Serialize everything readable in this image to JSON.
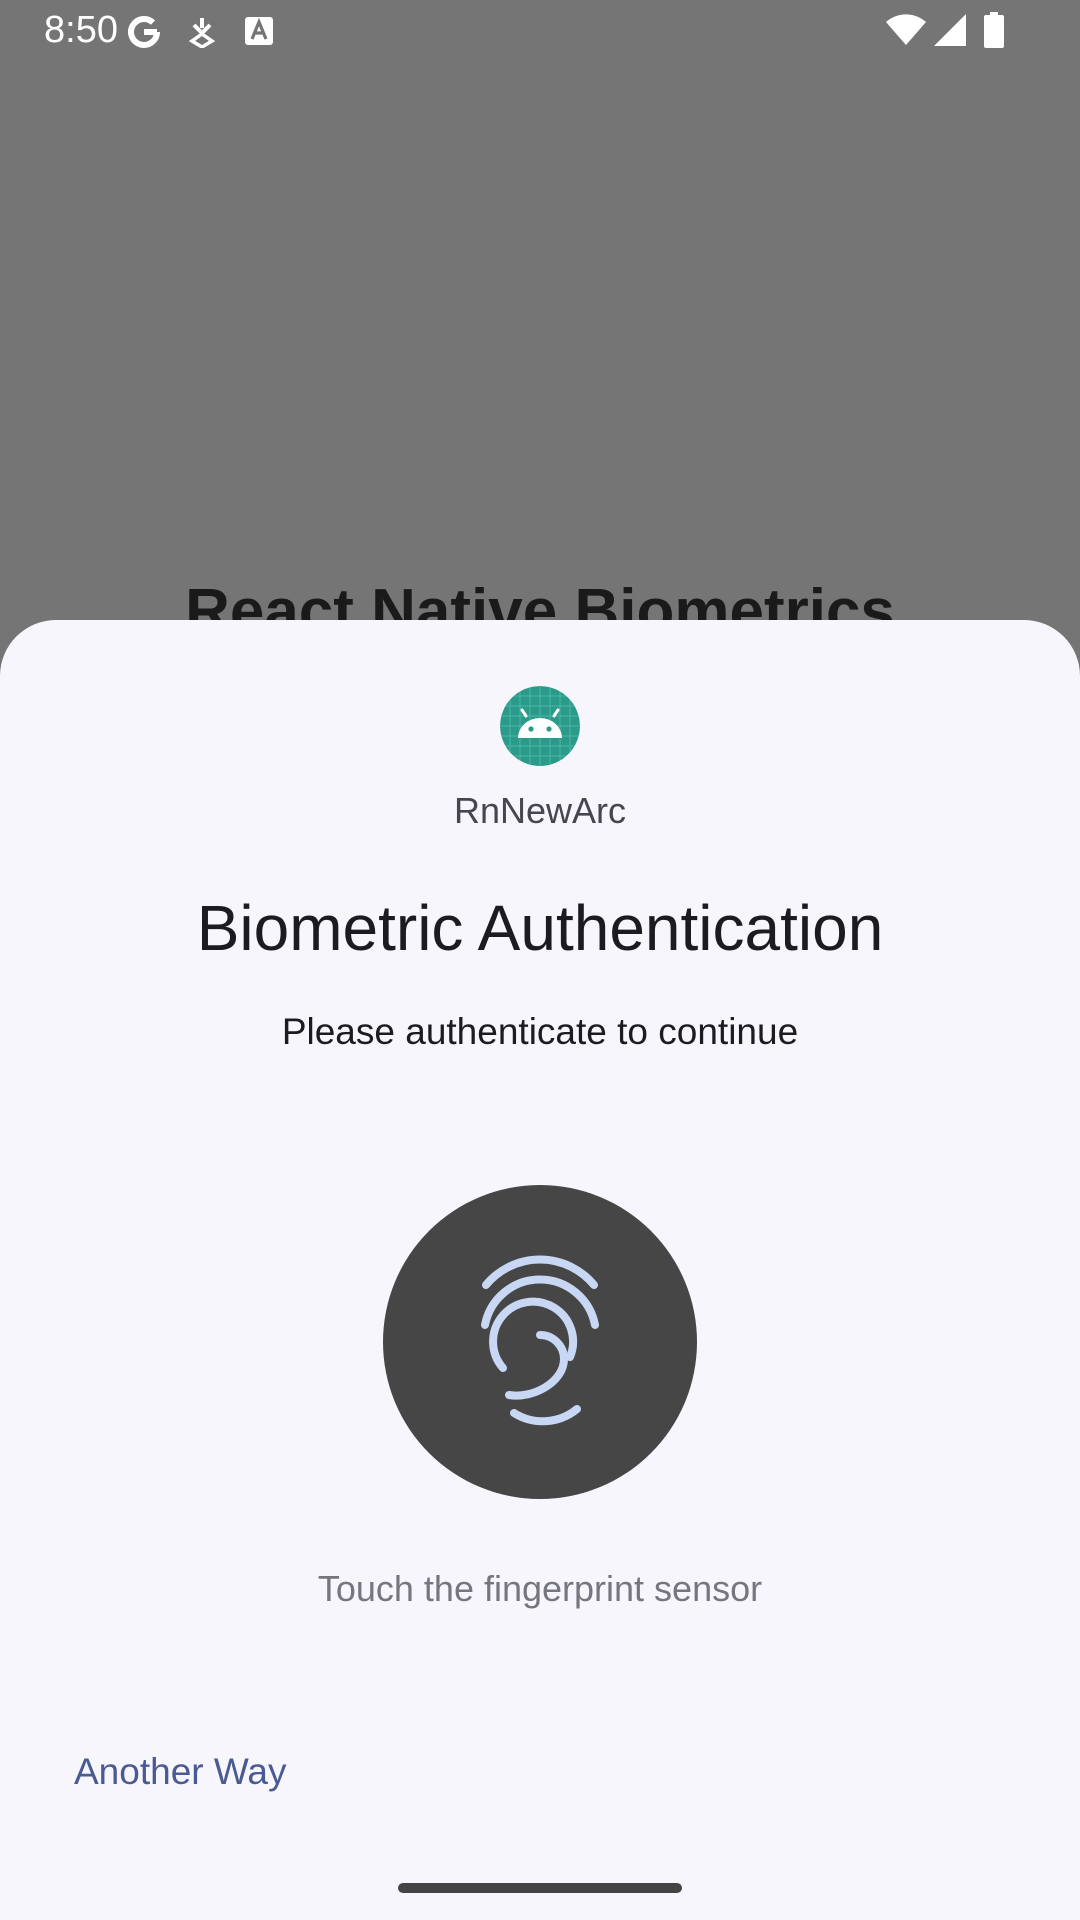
{
  "status_bar": {
    "time": "8:50",
    "left_icons": [
      "google-icon",
      "download-icon",
      "font-icon"
    ],
    "right_icons": [
      "wifi-icon",
      "cellular-signal-icon",
      "battery-icon"
    ]
  },
  "background_app": {
    "title": "React Native Biometrics"
  },
  "biometric_prompt": {
    "app_icon": "android-icon",
    "app_name": "RnNewArc",
    "title": "Biometric Authentication",
    "subtitle": "Please authenticate to continue",
    "fingerprint_icon": "fingerprint-icon",
    "hint": "Touch the fingerprint sensor",
    "negative_button": "Another Way"
  },
  "colors": {
    "scrim": "#757575",
    "sheet_background": "#f7f6fc",
    "fingerprint_circle": "#464646",
    "fingerprint_stroke": "#c8d8f4",
    "app_icon_bg": "#2a9a8a",
    "link": "#4a5a92"
  }
}
